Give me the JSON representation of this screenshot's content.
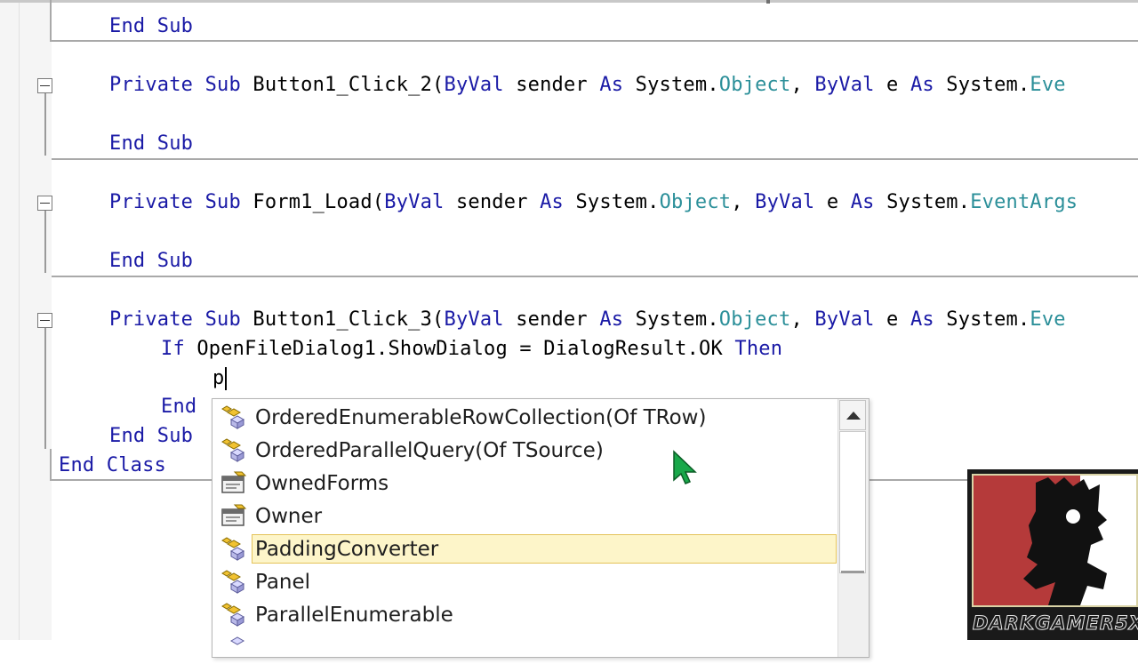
{
  "code": {
    "line_end_sub_1": "End Sub",
    "line_sub_button_click_2": {
      "kw1": "Private",
      "kw2": "Sub",
      "name": "Button1_Click_2(",
      "kw3": "ByVal",
      "p1": "sender",
      "kw4": "As",
      "ns1": "System.",
      "ty1": "Object",
      "comma": ",",
      "kw5": "ByVal",
      "p2": "e",
      "kw6": "As",
      "ns2": "System.",
      "ty2": "Eve"
    },
    "line_end_sub_2": "End Sub",
    "line_sub_form_load": {
      "kw1": "Private",
      "kw2": "Sub",
      "name": "Form1_Load(",
      "kw3": "ByVal",
      "p1": "sender",
      "kw4": "As",
      "ns1": "System.",
      "ty1": "Object",
      "comma": ",",
      "kw5": "ByVal",
      "p2": "e",
      "kw6": "As",
      "ns2": "System.",
      "ty2": "EventArgs"
    },
    "line_end_sub_3": "End Sub",
    "line_sub_button_click_3": {
      "kw1": "Private",
      "kw2": "Sub",
      "name": "Button1_Click_3(",
      "kw3": "ByVal",
      "p1": "sender",
      "kw4": "As",
      "ns1": "System.",
      "ty1": "Object",
      "comma": ",",
      "kw5": "ByVal",
      "p2": "e",
      "kw6": "As",
      "ns2": "System.",
      "ty2": "Eve"
    },
    "line_if": {
      "kw_if": "If",
      "expr": "OpenFileDialog1.ShowDialog = DialogResult.OK",
      "kw_then": "Then"
    },
    "line_typed": "p",
    "line_end_if": "End",
    "line_end_sub_4": "End Sub",
    "line_end_class": "End Class"
  },
  "intellisense": {
    "items": [
      {
        "label": "OrderedEnumerableRowCollection(Of TRow)",
        "icon": "class-icon"
      },
      {
        "label": "OrderedParallelQuery(Of TSource)",
        "icon": "class-icon"
      },
      {
        "label": "OwnedForms",
        "icon": "property-icon"
      },
      {
        "label": "Owner",
        "icon": "property-icon"
      },
      {
        "label": "PaddingConverter",
        "icon": "class-icon",
        "selected": true
      },
      {
        "label": "Panel",
        "icon": "class-icon"
      },
      {
        "label": "ParallelEnumerable",
        "icon": "class-icon"
      }
    ]
  },
  "watermark": {
    "text": "DARKGAMER5X"
  },
  "colors": {
    "keyword": "#1a1aa6",
    "type": "#2b8f99",
    "selection": "#fdf5c9"
  }
}
